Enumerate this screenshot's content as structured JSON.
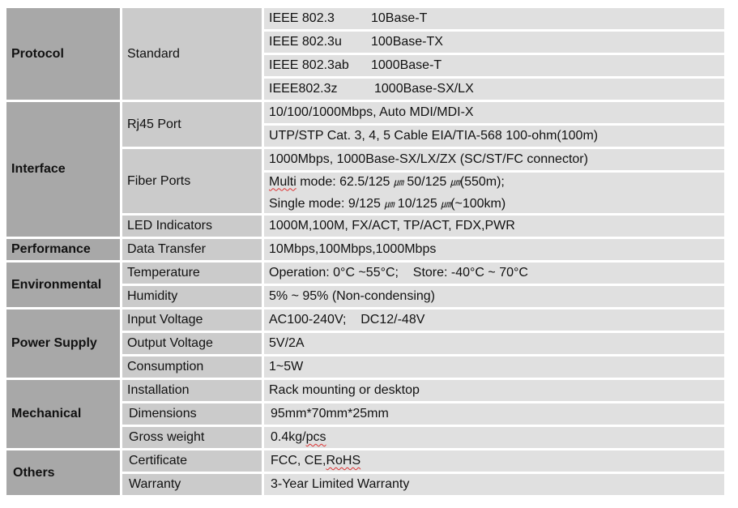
{
  "sections": [
    {
      "category": "Protocol",
      "items": [
        {
          "name": "Standard",
          "values": [
            [
              "IEEE 802.3",
              "10Base-T"
            ],
            [
              "IEEE 802.3u",
              "100Base-TX"
            ],
            [
              "IEEE 802.3ab",
              "1000Base-T"
            ],
            [
              "IEEE802.3z",
              "1000Base-SX/LX"
            ]
          ]
        }
      ]
    },
    {
      "category": "Interface",
      "items": [
        {
          "name": "Rj45 Port",
          "values": [
            "10/100/1000Mbps, Auto MDI/MDI-X",
            "UTP/STP Cat. 3, 4, 5 Cable EIA/TIA-568 100-ohm(100m)"
          ]
        },
        {
          "name": "Fiber Ports",
          "values": [
            "1000Mbps, 1000Base-SX/LX/ZX (SC/ST/FC connector)",
            {
              "multi_label": "Multi",
              "multi_rest": " mode: 62.5/125 ",
              "multi_b": "  50/125 ",
              "multi_end": "(550m);",
              "single_a": "Single mode: 9/125 ",
              "single_b": "  10/125 ",
              "single_end": "(~100km)",
              "micron": "㎛"
            }
          ]
        },
        {
          "name": "LED Indicators",
          "values": [
            "1000M,100M, FX/ACT, TP/ACT, FDX,PWR"
          ]
        }
      ]
    },
    {
      "category": "Performance",
      "items": [
        {
          "name": "Data Transfer",
          "values": [
            "10Mbps,100Mbps,1000Mbps"
          ]
        }
      ]
    },
    {
      "category": "Environmental",
      "items": [
        {
          "name": "Temperature",
          "values": [
            "Operation: 0°C ~55°C;    Store: -40°C ~ 70°C"
          ]
        },
        {
          "name": "Humidity",
          "values": [
            "5% ~ 95% (Non-condensing)"
          ]
        }
      ]
    },
    {
      "category": "Power Supply",
      "items": [
        {
          "name": "Input Voltage",
          "values": [
            "AC100-240V;    DC12/-48V"
          ]
        },
        {
          "name": "Output Voltage",
          "values": [
            "5V/2A"
          ]
        },
        {
          "name": "Consumption",
          "values": [
            "1~5W"
          ]
        }
      ]
    },
    {
      "category": "Mechanical",
      "items": [
        {
          "name": "Installation",
          "values": [
            "Rack mounting or desktop"
          ]
        },
        {
          "name": "Dimensions",
          "values": [
            "95mm*70mm*25mm"
          ]
        },
        {
          "name": "Gross weight",
          "values": [
            {
              "a": "0.4kg/",
              "b": "pcs"
            }
          ]
        }
      ]
    },
    {
      "category": "Others",
      "items": [
        {
          "name": "Certificate",
          "values": [
            {
              "a": "FCC, CE,",
              "b": "RoHS"
            }
          ]
        },
        {
          "name": "Warranty",
          "values": [
            "3-Year Limited Warranty"
          ]
        }
      ]
    }
  ],
  "colors": {
    "category_bg": "#a8a8a8",
    "item_bg": "#cbcbcb",
    "value_bg": "#e0e0e0"
  }
}
